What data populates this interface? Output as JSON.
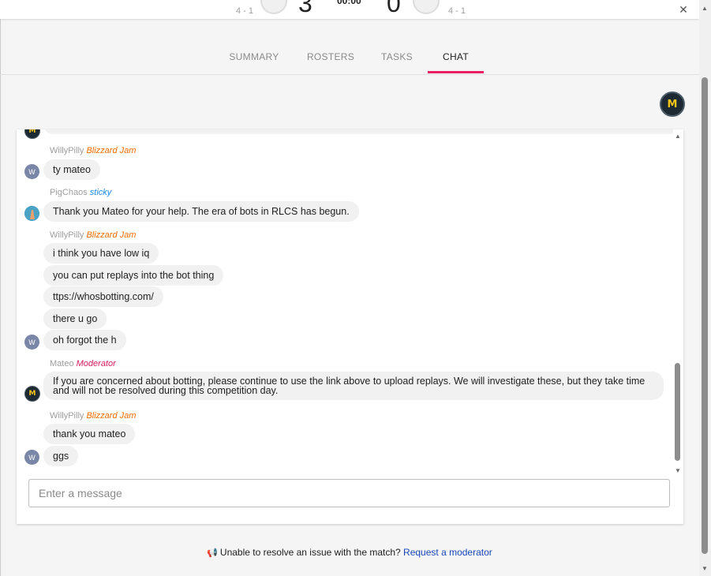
{
  "scoreboard": {
    "left_record": "4 - 1",
    "left_score": "3",
    "time": "00:00",
    "right_score": "0",
    "right_record": "4 - 1",
    "close_icon": "close-icon"
  },
  "tabs": [
    {
      "label": "SUMMARY"
    },
    {
      "label": "ROSTERS"
    },
    {
      "label": "TASKS"
    },
    {
      "label": "CHAT"
    }
  ],
  "active_tab": "CHAT",
  "colors": {
    "accent": "#e91e63",
    "link": "#1a47b8",
    "role_blizzard_jam": "#ef6c00",
    "role_sticky": "#1e88e5",
    "role_moderator": "#d81b60"
  },
  "chat": {
    "messages": [
      {
        "user": "WillyPilly",
        "role": "Blizzard Jam",
        "lines": [
          "ty mateo"
        ],
        "avatar": "W"
      },
      {
        "user": "PigChaos",
        "role": "sticky",
        "lines": [
          "Thank you Mateo for your help. The era of bots in RLCS has begun."
        ],
        "avatar": "pig-avatar"
      },
      {
        "user": "WillyPilly",
        "role": "Blizzard Jam",
        "lines": [
          "i think you have low iq",
          "you can put replays into the bot thing",
          "ttps://whosbotting.com/",
          "there u go",
          "oh forgot the h"
        ],
        "avatar": "W"
      },
      {
        "user": "Mateo",
        "role": "Moderator",
        "lines": [
          "If you are concerned about botting, please continue to use the link above to upload replays. We will investigate these, but they take time and will not be resolved during this competition day."
        ],
        "avatar": "M"
      },
      {
        "user": "WillyPilly",
        "role": "Blizzard Jam",
        "lines": [
          "thank you mateo",
          "ggs"
        ],
        "avatar": "W"
      }
    ],
    "input_placeholder": "Enter a message"
  },
  "footer": {
    "text": "Unable to resolve an issue with the match?",
    "link": "Request a moderator"
  }
}
